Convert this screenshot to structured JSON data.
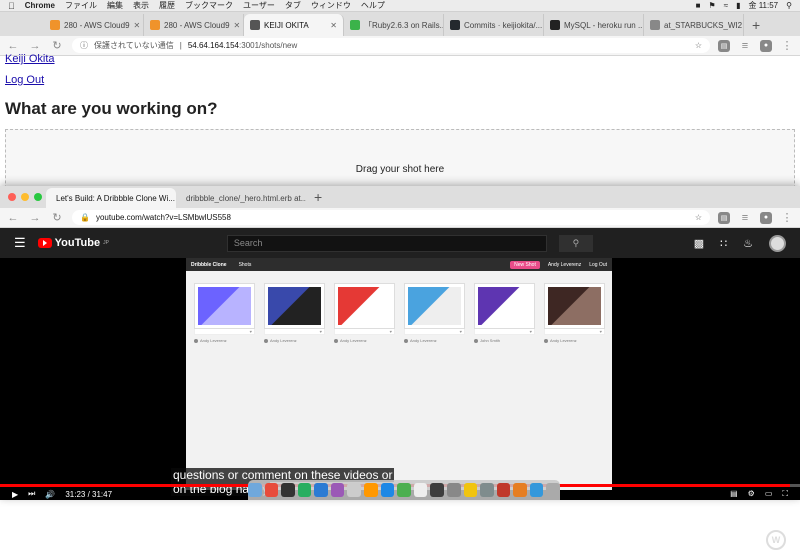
{
  "menubar": {
    "apple": "",
    "app_name": "Chrome",
    "items": [
      "ファイル",
      "編集",
      "表示",
      "履歴",
      "ブックマーク",
      "ユーザー",
      "タブ",
      "ウィンドウ",
      "ヘルプ"
    ],
    "clock": "金 11:57"
  },
  "browser1": {
    "tabs": [
      {
        "label": "280 - AWS Cloud9",
        "color": "#f0932b",
        "active": false
      },
      {
        "label": "280 - AWS Cloud9",
        "color": "#f0932b",
        "active": false
      },
      {
        "label": "KEIJI OKITA",
        "color": "#555555",
        "active": true
      },
      {
        "label": "「Ruby2.6.3 on Rails...",
        "color": "#3bb34a",
        "active": false
      },
      {
        "label": "Commits · keijiokita/...",
        "color": "#24292e",
        "active": false
      },
      {
        "label": "MySQL - heroku run ...",
        "color": "#222222",
        "active": false
      },
      {
        "label": "at_STARBUCKS_WI2",
        "color": "#888888",
        "active": false
      }
    ],
    "security_label": "保護されていない通信",
    "url_host": "54.64.164.154",
    "url_path": ":3001/shots/new"
  },
  "page": {
    "user_link": "Keiji Okita",
    "logout_link": "Log Out",
    "heading": "What are you working on?",
    "dropzone_text": "Drag your shot here"
  },
  "browser2": {
    "tabs": [
      {
        "label": "Let's Build: A Dribbble Clone Wi...",
        "color": "#ff0000",
        "active": true
      },
      {
        "label": "dribbble_clone/_hero.html.erb at...",
        "color": "#24292e",
        "active": false
      }
    ],
    "url": "youtube.com/watch?v=LSMbwlUS558"
  },
  "youtube": {
    "logo_text": "YouTube",
    "logo_region": "JP",
    "search_placeholder": "Search",
    "time_current": "31:23",
    "time_total": "31:47",
    "progress_fraction": 0.987,
    "caption_line1": "questions or comment on these videos or",
    "caption_line2": "on the blog happy"
  },
  "video_page": {
    "brand": "Dribbble Clone",
    "nav_shots": "Shots",
    "new_shot": "New Shot",
    "user": "Andy Leverenz",
    "logout": "Log Out",
    "shots": [
      {
        "author": "Andy Leverenz",
        "colors": [
          "#6c63ff",
          "#b8b3ff"
        ]
      },
      {
        "author": "Andy Leverenz",
        "colors": [
          "#3949ab",
          "#222222"
        ]
      },
      {
        "author": "Andy Leverenz",
        "colors": [
          "#e53935",
          "#ffffff"
        ]
      },
      {
        "author": "Andy Leverenz",
        "colors": [
          "#4aa3df",
          "#eeeeee"
        ]
      },
      {
        "author": "John Smith",
        "colors": [
          "#5e35b1",
          "#ffffff"
        ]
      },
      {
        "author": "Andy Leverenz",
        "colors": [
          "#3e2723",
          "#8d6e63"
        ]
      }
    ]
  },
  "dock_colors": [
    "#6fa8dc",
    "#e74c3c",
    "#333333",
    "#27ae60",
    "#2b7bd3",
    "#9b59b6",
    "#cccccc",
    "#ff9800",
    "#1e88e5",
    "#4caf50",
    "#eeeeee",
    "#3d3d3d",
    "#888888",
    "#f1c40f",
    "#7f8c8d",
    "#c0392b",
    "#e67e22",
    "#3498db",
    "#aaaaaa"
  ]
}
